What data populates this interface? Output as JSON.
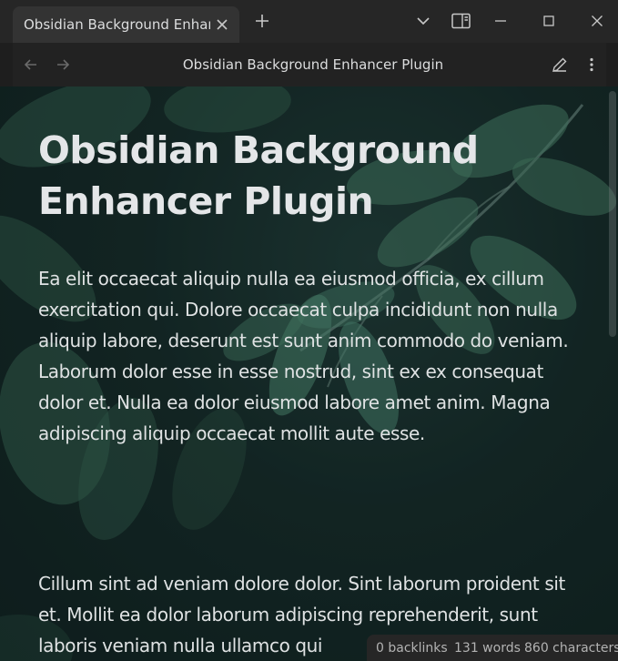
{
  "tab": {
    "title": "Obsidian Background Enhancer Plugin"
  },
  "header": {
    "title": "Obsidian Background Enhancer Plugin"
  },
  "document": {
    "title": "Obsidian Background Enhancer Plugin",
    "paragraphs": [
      "Ea elit occaecat aliquip nulla ea eiusmod officia, ex cillum exercitation qui. Dolore occaecat culpa incididunt non nulla aliquip labore, deserunt est sunt anim commodo do veniam. Laborum dolor esse in esse nostrud, sint ex ex consequat dolor et. Nulla ea dolor eiusmod labore amet anim. Magna adipiscing aliquip occaecat mollit aute esse.",
      "Cillum sint ad veniam dolore dolor. Sint laborum proident sit et. Mollit ea dolor laborum adipiscing reprehenderit, sunt laboris veniam nulla ullamco qui"
    ]
  },
  "status_bar": {
    "backlinks": "0 backlinks",
    "words": "131 words",
    "characters": "860 characters"
  },
  "icons": {
    "tab_close": "close-icon",
    "new_tab": "plus-icon",
    "tab_list": "chevron-down-icon",
    "sidebar_toggle": "sidebar-toggle-icon",
    "minimize": "minimize-icon",
    "maximize": "maximize-icon",
    "close_window": "close-icon",
    "back": "arrow-left-icon",
    "forward": "arrow-right-icon",
    "edit": "pencil-icon",
    "more": "more-vertical-icon"
  }
}
